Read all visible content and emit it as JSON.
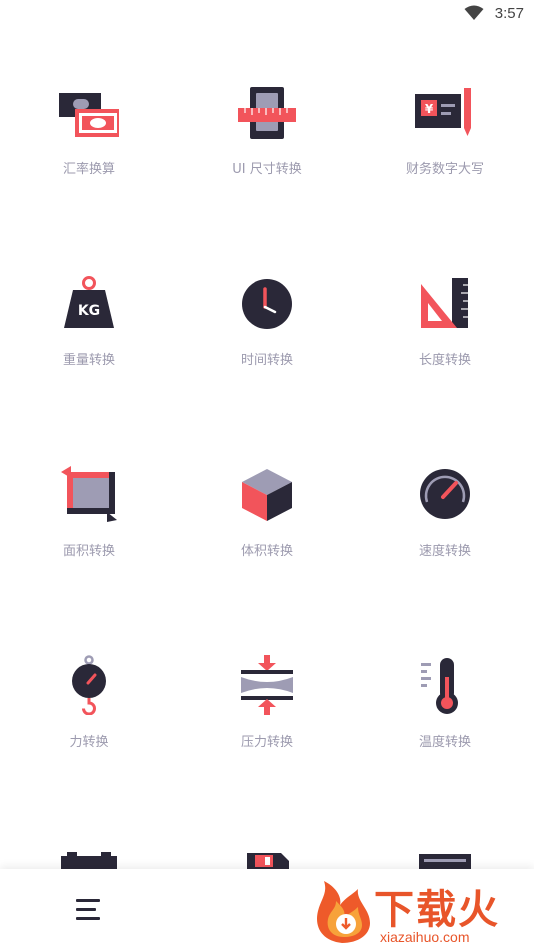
{
  "status_bar": {
    "time": "3:57"
  },
  "colors": {
    "dark": "#2a2838",
    "red": "#f2545b",
    "grey": "#9e9cb4",
    "label": "#9c9aae"
  },
  "tools": [
    {
      "label": "汇率换算",
      "icon": "money-exchange-icon"
    },
    {
      "label": "UI 尺寸转换",
      "icon": "phone-ruler-icon"
    },
    {
      "label": "财务数字大写",
      "icon": "cheque-pen-icon"
    },
    {
      "label": "重量转换",
      "icon": "kg-weight-icon"
    },
    {
      "label": "时间转换",
      "icon": "clock-icon"
    },
    {
      "label": "长度转换",
      "icon": "set-square-ruler-icon"
    },
    {
      "label": "面积转换",
      "icon": "area-square-icon"
    },
    {
      "label": "体积转换",
      "icon": "cube-icon"
    },
    {
      "label": "速度转换",
      "icon": "speedometer-icon"
    },
    {
      "label": "力转换",
      "icon": "hanging-scale-icon"
    },
    {
      "label": "压力转换",
      "icon": "pressure-icon"
    },
    {
      "label": "温度转换",
      "icon": "thermometer-icon"
    },
    {
      "label": "",
      "icon": "battery-icon"
    },
    {
      "label": "",
      "icon": "floppy-disk-icon"
    },
    {
      "label": "",
      "icon": "monitor-icon"
    }
  ],
  "watermark": {
    "title": "下载火",
    "url": "xiazaihuo.com"
  }
}
